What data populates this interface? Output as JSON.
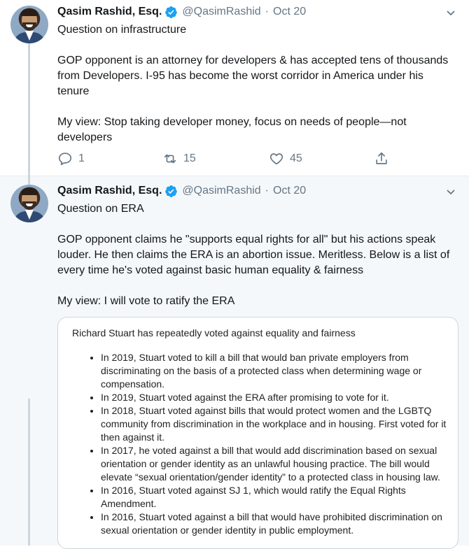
{
  "tweets": [
    {
      "name": "Qasim Rashid, Esq.",
      "handle": "@QasimRashid",
      "separator": "·",
      "date": "Oct 20",
      "text": "Question on infrastructure\n\nGOP opponent is an attorney for developers & has accepted tens of thousands from Developers. I-95 has become the worst corridor in America under his tenure\n\nMy view: Stop taking developer money, focus on needs of people—not developers",
      "replies": "1",
      "retweets": "15",
      "likes": "45"
    },
    {
      "name": "Qasim Rashid, Esq.",
      "handle": "@QasimRashid",
      "separator": "·",
      "date": "Oct 20",
      "text": "Question on ERA\n\nGOP opponent claims he \"supports equal rights for all\" but his actions speak louder. He then claims the ERA is an abortion issue. Meritless. Below is a list of every time he's voted against basic human equality & fairness\n\nMy view: I will vote to ratify the ERA",
      "card": {
        "title": "Richard Stuart has repeatedly voted against equality and fairness",
        "items": [
          "In 2019, Stuart voted to kill a bill that would ban private employers from discriminating on the basis of a protected class when determining wage or compensation.",
          "In 2019, Stuart voted against the ERA after promising to vote for it.",
          "In 2018, Stuart voted against bills that would protect women and the LGBTQ community from discrimination in the workplace and in housing. First voted for it then against it.",
          "In 2017, he voted against a bill that would add discrimination based on sexual orientation or gender identity as an unlawful housing practice. The bill would elevate “sexual orientation/gender identity” to a protected class in housing law.",
          "In 2016, Stuart voted against SJ 1, which would ratify the Equal Rights Amendment.",
          "In 2016, Stuart voted against a bill that would have prohibited discrimination on sexual orientation or gender identity in public employment."
        ]
      }
    }
  ],
  "colors": {
    "verified": "#1da1f2",
    "secondary": "#657786",
    "thread": "#ccd6dd"
  },
  "icons": [
    "verified-badge-icon",
    "chevron-down-icon",
    "reply-icon",
    "retweet-icon",
    "like-icon",
    "share-icon"
  ]
}
